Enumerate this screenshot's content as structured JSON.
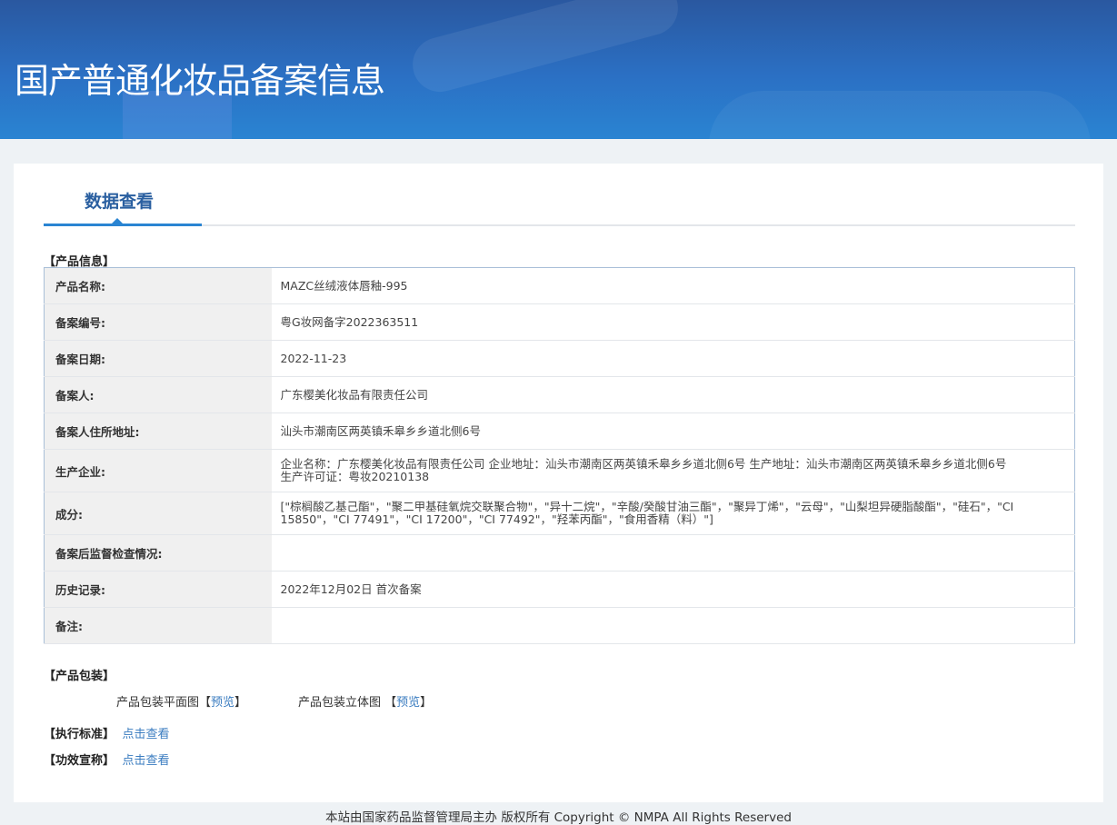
{
  "header": {
    "title": "国产普通化妆品备案信息"
  },
  "tab": {
    "label": "数据查看"
  },
  "product_info": {
    "section_title": "【产品信息】",
    "rows": [
      {
        "label": "产品名称:",
        "value": "MAZC丝绒液体唇釉-995"
      },
      {
        "label": "备案编号:",
        "value": "粤G妆网备字2022363511"
      },
      {
        "label": "备案日期:",
        "value": "2022-11-23"
      },
      {
        "label": "备案人:",
        "value": "广东樱美化妆品有限责任公司"
      },
      {
        "label": "备案人住所地址:",
        "value": "汕头市潮南区两英镇禾皋乡乡道北侧6号"
      },
      {
        "label": "生产企业:",
        "value": "企业名称：广东樱美化妆品有限责任公司 企业地址：汕头市潮南区两英镇禾皋乡乡道北侧6号 生产地址：汕头市潮南区两英镇禾皋乡乡道北侧6号 生产许可证：粤妆20210138"
      },
      {
        "label": "成分:",
        "value": "[\"棕榈酸乙基己酯\"，\"聚二甲基硅氧烷交联聚合物\"，\"异十二烷\"，\"辛酸/癸酸甘油三酯\"，\"聚异丁烯\"，\"云母\"，\"山梨坦异硬脂酸酯\"，\"硅石\"，\"CI 15850\"，\"CI 77491\"，\"CI 17200\"，\"CI 77492\"，\"羟苯丙酯\"，\"食用香精（料）\"]"
      },
      {
        "label": "备案后监督检查情况:",
        "value": ""
      },
      {
        "label": "历史记录:",
        "value": "2022年12月02日 首次备案"
      },
      {
        "label": "备注:",
        "value": ""
      }
    ]
  },
  "packaging": {
    "section_title": "【产品包装】",
    "flat_label": "产品包装平面图【",
    "flat_link": "预览",
    "flat_close": "】",
    "solid_label": "产品包装立体图 【",
    "solid_link": "预览",
    "solid_close": "】"
  },
  "standard": {
    "label": "【执行标准】",
    "link": "点击查看"
  },
  "efficacy": {
    "label": "【功效宣称】",
    "link": "点击查看"
  },
  "footer": {
    "text": "本站由国家药品监督管理局主办 版权所有 Copyright © NMPA All Rights Reserved"
  }
}
